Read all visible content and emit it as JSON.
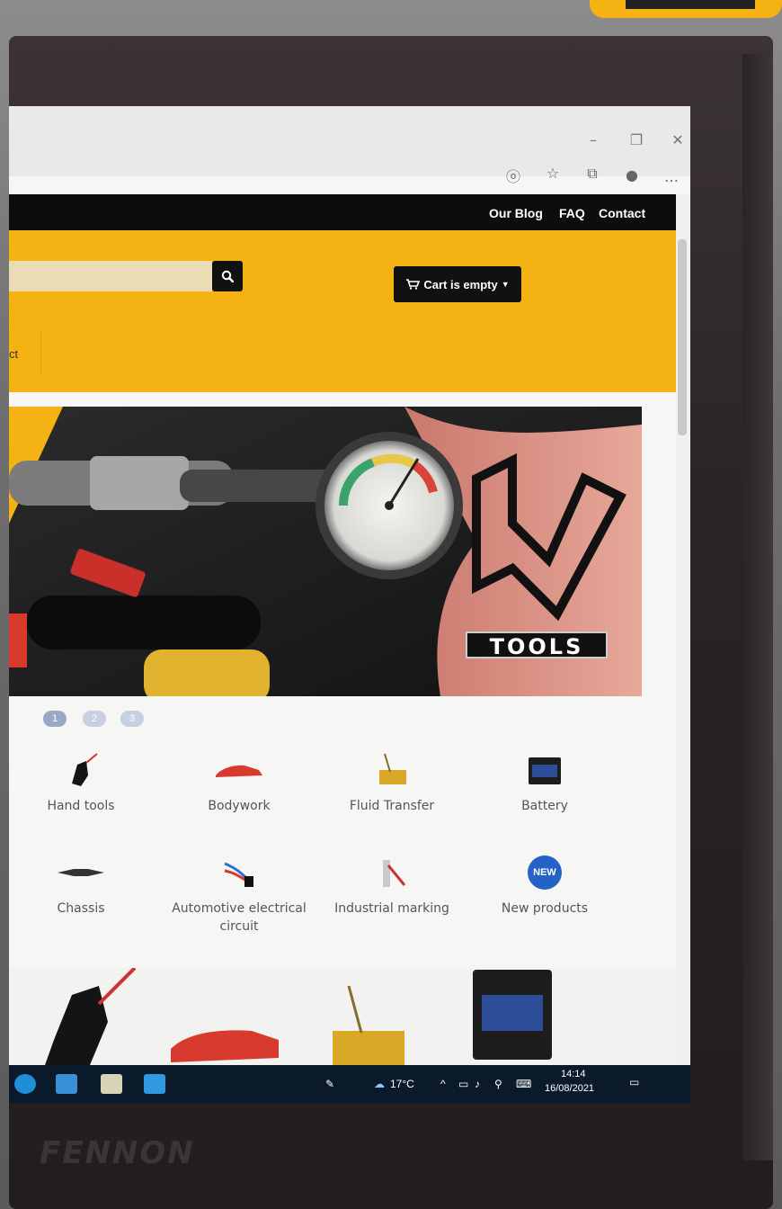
{
  "header_links": {
    "blog": "Our Blog",
    "faq": "FAQ",
    "contact": "Contact"
  },
  "search": {
    "value": "",
    "placeholder": ""
  },
  "cart": {
    "label": "Cart is empty"
  },
  "nav": {
    "fragment": "ct"
  },
  "hero": {
    "brand_label": "TOOLS"
  },
  "carousel": {
    "dots": [
      "1",
      "2",
      "3"
    ],
    "active": 1
  },
  "categories": [
    {
      "label": "Hand tools",
      "icon": "hand-tools-icon"
    },
    {
      "label": "Bodywork",
      "icon": "car-body-icon"
    },
    {
      "label": "Fluid Transfer",
      "icon": "fluid-transfer-icon"
    },
    {
      "label": "Battery",
      "icon": "battery-icon"
    },
    {
      "label": "Chassis",
      "icon": "chassis-icon"
    },
    {
      "label": "Automotive electrical circuit",
      "icon": "wiring-icon"
    },
    {
      "label": "Industrial marking",
      "icon": "marker-icon"
    },
    {
      "label": "New products",
      "icon": "new-badge-icon",
      "badge": "NEW"
    }
  ],
  "taskbar": {
    "temperature": "17°C",
    "time": "14:14",
    "date": "16/08/2021"
  },
  "monitor": {
    "brand": "FENNON"
  },
  "colors": {
    "accent": "#f5b313",
    "topbar": "#0d0d0d",
    "new_badge": "#2463c6",
    "taskbar": "#0b1a2a"
  }
}
